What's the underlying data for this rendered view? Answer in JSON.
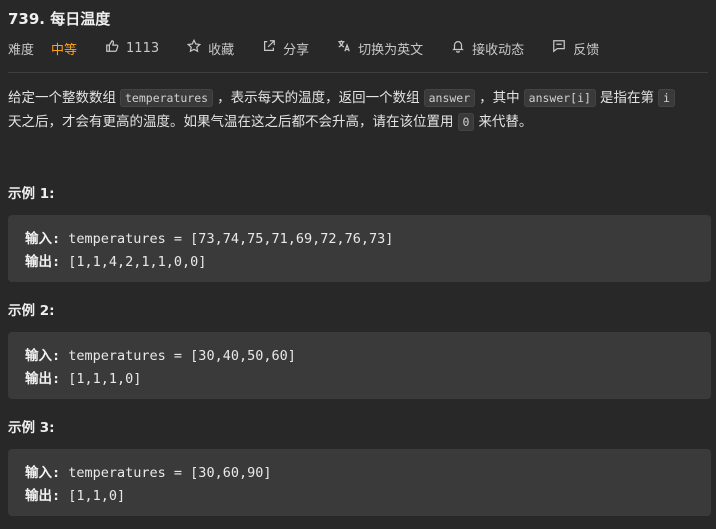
{
  "problem": {
    "title": "739. 每日温度",
    "difficulty_label": "难度",
    "difficulty": "中等",
    "likes": "1113",
    "favorite_label": "收藏",
    "share_label": "分享",
    "translate_label": "切换为英文",
    "subscribe_label": "接收动态",
    "feedback_label": "反馈"
  },
  "description": {
    "p1_a": "给定一个整数数组",
    "code1": "temperatures",
    "p1_b": "，表示每天的温度，返回一个数组",
    "code2": "answer",
    "p1_c": "，其中",
    "code3": "answer[i]",
    "p1_d": "是指在第",
    "code4": "i",
    "p2_a": "天之后，才会有更高的温度。如果气温在这之后都不会升高，请在该位置用",
    "code5": "0",
    "p2_b": "来代替。"
  },
  "examples": [
    {
      "title": "示例 1:",
      "input_label": "输入:",
      "input": " temperatures = [73,74,75,71,69,72,76,73]",
      "output_label": "输出:",
      "output": " [1,1,4,2,1,1,0,0]"
    },
    {
      "title": "示例 2:",
      "input_label": "输入:",
      "input": " temperatures = [30,40,50,60]",
      "output_label": "输出:",
      "output": " [1,1,1,0]"
    },
    {
      "title": "示例 3:",
      "input_label": "输入:",
      "input": " temperatures = [30,60,90]",
      "output_label": "输出:",
      "output": " [1,1,0]"
    }
  ],
  "icons": {
    "like": "thumbs-up-icon",
    "favorite": "star-icon",
    "share": "share-icon",
    "translate": "translate-icon",
    "subscribe": "bell-icon",
    "feedback": "feedback-icon"
  },
  "colors": {
    "background": "#282828",
    "difficulty_medium": "#ffa116",
    "code_bg": "#3a3a3a"
  }
}
